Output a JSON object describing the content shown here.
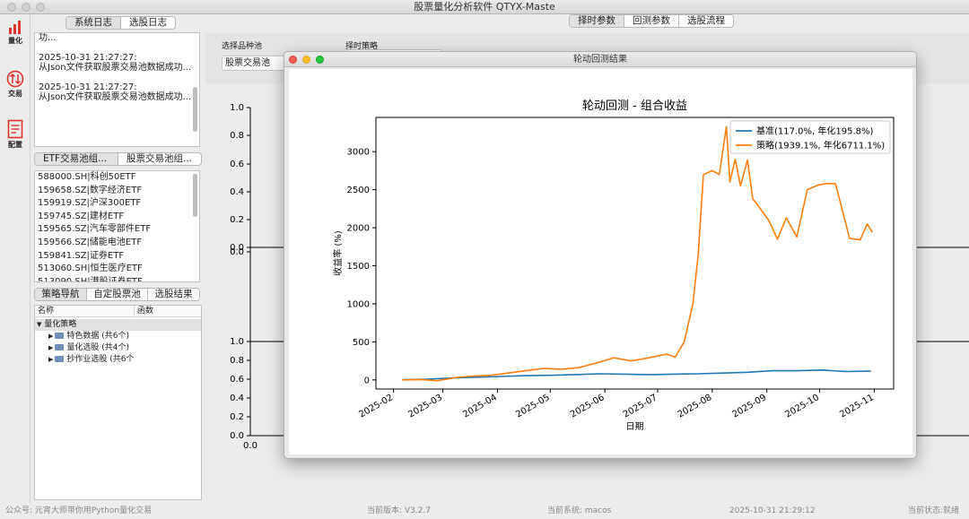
{
  "window": {
    "title": "股票量化分析软件 QTYX-Maste"
  },
  "toolbar": [
    {
      "id": "quant",
      "label": "量化",
      "color": "#e0352b"
    },
    {
      "id": "trade",
      "label": "交易",
      "color": "#e0352b"
    },
    {
      "id": "config",
      "label": "配置",
      "color": "#e0352b"
    }
  ],
  "log_tabs": [
    "系统日志",
    "选股日志"
  ],
  "log_entries": [
    {
      "time": "",
      "text": "功..."
    },
    {
      "time": "2025-10-31 21:27:27:",
      "text": "从Json文件获取股票交易池数据成功..."
    },
    {
      "time": "2025-10-31 21:27:27:",
      "text": "从Json文件获取股票交易池数据成功..."
    }
  ],
  "pool_tabs": [
    "ETF交易池组...",
    "股票交易池组..."
  ],
  "pool_items": [
    "588000.SH|科创50ETF",
    "159658.SZ|数字经济ETF",
    "159919.SZ|沪深300ETF",
    "159745.SZ|建材ETF",
    "159565.SZ|汽车零部件ETF",
    "159566.SZ|储能电池ETF",
    "159841.SZ|证券ETF",
    "513060.SH|恒生医疗ETF",
    "513090.SH|港股证券ETF"
  ],
  "nav_tabs": [
    "策略导航",
    "自定股票池",
    "选股结果"
  ],
  "tree": {
    "col_name": "名称",
    "col_func": "函数",
    "root": "量化策略",
    "children": [
      "特色数据 (共6个)",
      "量化选股 (共4个)",
      "抄作业选股 (共6个"
    ]
  },
  "main_tabs": [
    "择时参数",
    "回测参数",
    "选股流程"
  ],
  "fields": {
    "pool_label": "选择品种池",
    "pool_value": "股票交易池",
    "timing_label": "择时策略"
  },
  "bg_axes": {
    "ticks": [
      "1.0",
      "0.8",
      "0.6",
      "0.4",
      "0.2",
      "0.0",
      "0.0"
    ],
    "lower_ticks": [
      "1.0",
      "0.8",
      "0.6",
      "0.4",
      "0.2",
      "0.0"
    ],
    "xzero": "0.0"
  },
  "modal": {
    "title": "轮动回测结果"
  },
  "chart_data": {
    "type": "line",
    "title": "轮动回测 - 组合收益",
    "xlabel": "日期",
    "ylabel": "收益率 (%)",
    "x_ticks": [
      "2025-02",
      "2025-03",
      "2025-04",
      "2025-05",
      "2025-06",
      "2025-07",
      "2025-08",
      "2025-09",
      "2025-10",
      "2025-11"
    ],
    "y_ticks": [
      0,
      500,
      1000,
      1500,
      2000,
      2500,
      3000
    ],
    "xlim": [
      "2025-01-22",
      "2025-11-12"
    ],
    "ylim": [
      -120,
      3450
    ],
    "legend_position": "top-right",
    "series": [
      {
        "name": "基准(117.0%, 年化195.8%)",
        "color": "#1f77b4",
        "x": [
          "2025-02-06",
          "2025-02-20",
          "2025-03-06",
          "2025-03-20",
          "2025-04-03",
          "2025-04-17",
          "2025-05-01",
          "2025-05-15",
          "2025-05-29",
          "2025-06-12",
          "2025-06-26",
          "2025-07-10",
          "2025-07-24",
          "2025-08-07",
          "2025-08-21",
          "2025-09-04",
          "2025-09-18",
          "2025-10-02",
          "2025-10-16",
          "2025-10-30"
        ],
        "values": [
          2,
          10,
          25,
          35,
          45,
          55,
          60,
          70,
          80,
          75,
          70,
          75,
          80,
          90,
          100,
          120,
          120,
          130,
          110,
          117
        ]
      },
      {
        "name": "策略(1939.1%, 年化6711.1%)",
        "color": "#ff7f0e",
        "x": [
          "2025-02-06",
          "2025-02-16",
          "2025-02-26",
          "2025-03-08",
          "2025-03-18",
          "2025-03-28",
          "2025-04-07",
          "2025-04-17",
          "2025-04-27",
          "2025-05-07",
          "2025-05-17",
          "2025-05-27",
          "2025-06-06",
          "2025-06-16",
          "2025-06-26",
          "2025-07-06",
          "2025-07-11",
          "2025-07-16",
          "2025-07-21",
          "2025-07-24",
          "2025-07-27",
          "2025-08-01",
          "2025-08-05",
          "2025-08-09",
          "2025-08-11",
          "2025-08-14",
          "2025-08-17",
          "2025-08-21",
          "2025-08-24",
          "2025-08-28",
          "2025-09-02",
          "2025-09-07",
          "2025-09-12",
          "2025-09-18",
          "2025-09-24",
          "2025-09-30",
          "2025-10-05",
          "2025-10-10",
          "2025-10-18",
          "2025-10-24",
          "2025-10-28",
          "2025-10-31"
        ],
        "values": [
          0,
          5,
          -10,
          30,
          50,
          60,
          90,
          120,
          150,
          140,
          160,
          220,
          290,
          250,
          290,
          340,
          300,
          500,
          1000,
          1650,
          2700,
          2750,
          2700,
          3330,
          2600,
          2900,
          2550,
          2890,
          2380,
          2260,
          2100,
          1850,
          2130,
          1880,
          2500,
          2560,
          2580,
          2580,
          1860,
          1840,
          2050,
          1939
        ]
      }
    ]
  }
}
